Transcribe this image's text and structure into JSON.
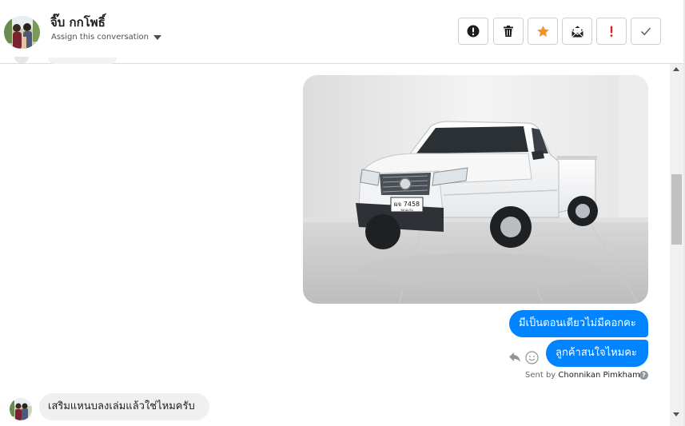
{
  "header": {
    "contact_name": "จิ๊บ กกโพธิ์",
    "assign_label": "Assign this conversation"
  },
  "toolbar": [
    {
      "name": "spam-icon",
      "label": "!"
    },
    {
      "name": "trash-icon",
      "label": ""
    },
    {
      "name": "star-icon",
      "label": ""
    },
    {
      "name": "mark-unread-icon",
      "label": ""
    },
    {
      "name": "exclamation-icon",
      "label": "!"
    },
    {
      "name": "checkmark-icon",
      "label": ""
    }
  ],
  "messages": {
    "outgoing_1": "มีเป็นตอนเดียวไม่มีคอกคะ",
    "outgoing_2": "ลูกค้าสนใจไหมคะ",
    "incoming_1": "เสริมแหนบลงเล่มแล้วใช่ไหมครับ"
  },
  "sent_by": {
    "prefix": "Sent by",
    "name": "Chonnikan Pimkham"
  },
  "photo": {
    "plate_line1": "ผจ 7458",
    "plate_line2": "ขอนแก่น"
  },
  "colors": {
    "outgoing_bubble": "#0084ff",
    "incoming_bubble": "#f1f0f0",
    "star": "#f0932b",
    "flag_red": "#e02020"
  }
}
